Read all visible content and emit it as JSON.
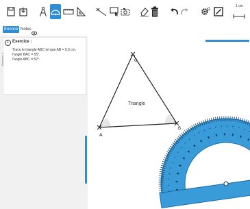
{
  "toolbar": {
    "items": [
      "save-icon",
      "export-icon",
      "compass-icon",
      "protractor-icon",
      "ruler-icon",
      "set-square-icon",
      "point-icon",
      "select-icon",
      "camera-icon",
      "eraser-icon",
      "trash-icon",
      "undo-icon",
      "redo-icon",
      "settings-icon",
      "edit-icon",
      "scale-icon"
    ],
    "scale_label": "1 cm"
  },
  "tabs": {
    "enonce": "Énoncé",
    "notes": "Notes"
  },
  "exercise": {
    "side_label": "Exercice 1",
    "number": "1",
    "title": "Exercice :",
    "lines": [
      "Trace le triangle ABC tel que AB = 5,5 cm,",
      "l'angle BAC = 55°,",
      "l'angle ABC = 52°."
    ]
  },
  "canvas": {
    "triangle_label": "Triangle",
    "point_a": "A",
    "point_b": "B",
    "point_c": "C"
  },
  "colors": {
    "accent": "#2f8dd6",
    "protractor": "#3a9bd9"
  }
}
